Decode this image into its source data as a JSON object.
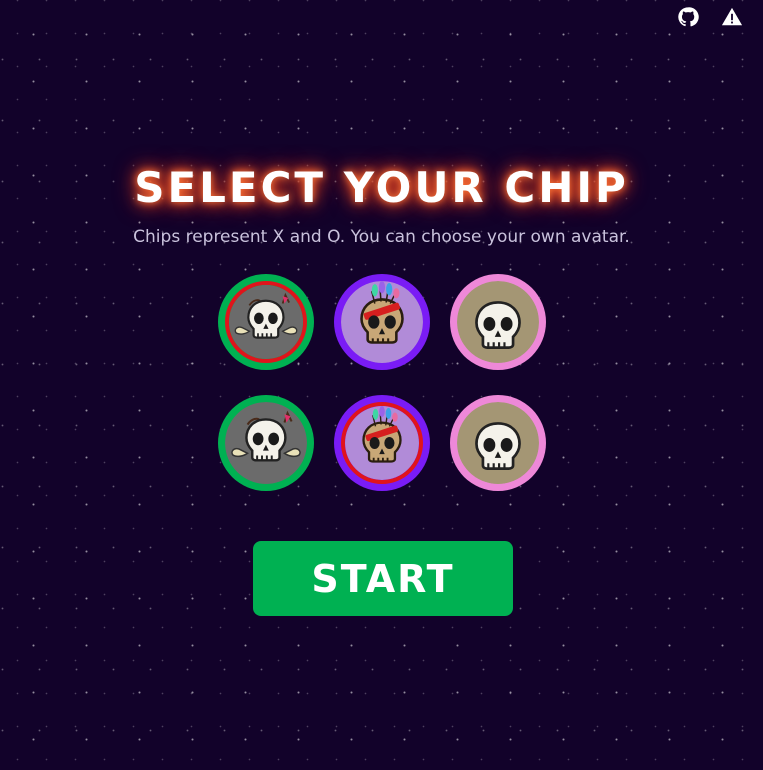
{
  "header": {
    "icons": [
      "github-icon",
      "warning-icon"
    ]
  },
  "title": "SELECT YOUR CHIP",
  "subtitle": "Chips represent X and O. You can choose your own avatar.",
  "chips": {
    "row1": [
      {
        "avatar": "winged-skull",
        "ring_color": "#00b152",
        "selected": true
      },
      {
        "avatar": "feather-skull",
        "ring_color": "#7a1cf5",
        "selected": false
      },
      {
        "avatar": "plain-skull",
        "ring_color": "#ee88d8",
        "selected": false
      }
    ],
    "row2": [
      {
        "avatar": "winged-skull",
        "ring_color": "#00b152",
        "selected": false
      },
      {
        "avatar": "feather-skull",
        "ring_color": "#7a1cf5",
        "selected": true
      },
      {
        "avatar": "plain-skull",
        "ring_color": "#ee88d8",
        "selected": false
      }
    ]
  },
  "colors": {
    "background": "#12022a",
    "title_glow": "#ff4d1f",
    "start_button": "#00b152",
    "selected_ring": "#e0141c"
  },
  "start_button_label": "START"
}
